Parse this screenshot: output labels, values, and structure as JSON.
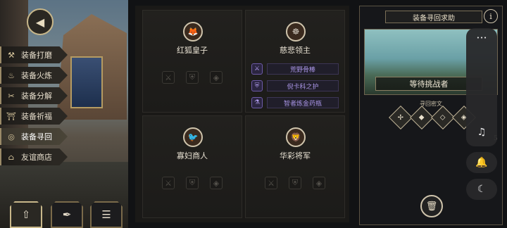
{
  "menu": {
    "items": [
      {
        "label": "装备打磨",
        "icon": "hammer-icon",
        "glyph": "⚒"
      },
      {
        "label": "装备火炼",
        "icon": "flame-icon",
        "glyph": "🔥"
      },
      {
        "label": "装备分解",
        "icon": "split-icon",
        "glyph": "✂"
      },
      {
        "label": "装备祈福",
        "icon": "shrine-icon",
        "glyph": "⛩"
      },
      {
        "label": "装备寻回",
        "icon": "retrieve-icon",
        "glyph": "◎"
      },
      {
        "label": "友谊商店",
        "icon": "shop-icon",
        "glyph": "⌂"
      }
    ],
    "active_index": 4
  },
  "cards": [
    {
      "name": "红狐皇子",
      "portrait": "🦊"
    },
    {
      "name": "慈悲领主",
      "portrait": "☸",
      "items": [
        "荒野骨棒",
        "倪卡科之护",
        "智者炼金药瓶"
      ]
    },
    {
      "name": "寡妇商人",
      "portrait": "🐦"
    },
    {
      "name": "华彩将军",
      "portrait": "🦁"
    }
  ],
  "right": {
    "title": "装备寻回求助",
    "boss_label": "等待挑战者",
    "sub_label": "寻回密文",
    "count": "5"
  },
  "colors": {
    "accent": "#c8b78a",
    "epic": "#a995e6"
  }
}
